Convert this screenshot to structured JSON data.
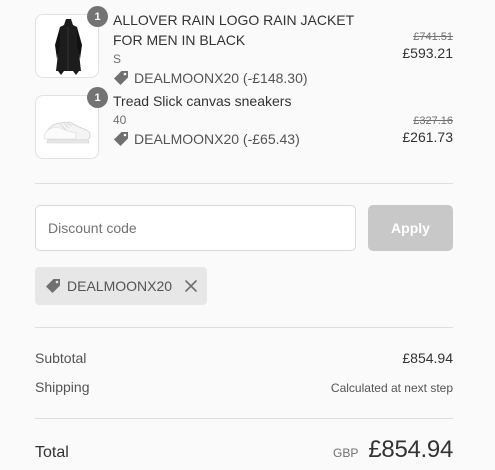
{
  "items": [
    {
      "quantity": "1",
      "title": "ALLOVER RAIN LOGO RAIN JACKET FOR MEN IN BLACK",
      "variant": "S",
      "discount": "DEALMOONX20 (-£148.30)",
      "original_price": "£741.51",
      "price": "£593.21",
      "image_icon": "black-rain-jacket-image"
    },
    {
      "quantity": "1",
      "title": "Tread Slick canvas sneakers",
      "variant": "40",
      "discount": "DEALMOONX20 (-£65.43)",
      "original_price": "£327.16",
      "price": "£261.73",
      "image_icon": "white-sneakers-image"
    }
  ],
  "discount_form": {
    "placeholder": "Discount code",
    "value": "",
    "apply_label": "Apply"
  },
  "applied_code": {
    "code": "DEALMOONX20",
    "remove_icon": "close-icon"
  },
  "totals": {
    "subtotal_label": "Subtotal",
    "subtotal_value": "£854.94",
    "shipping_label": "Shipping",
    "shipping_value": "Calculated at next step",
    "total_label": "Total",
    "currency": "GBP",
    "total_value": "£854.94"
  },
  "colors": {
    "badge": "#737373",
    "apply_disabled": "#c8c8c8",
    "chip_bg": "#e7e7e7",
    "tag_icon": "#707070"
  }
}
